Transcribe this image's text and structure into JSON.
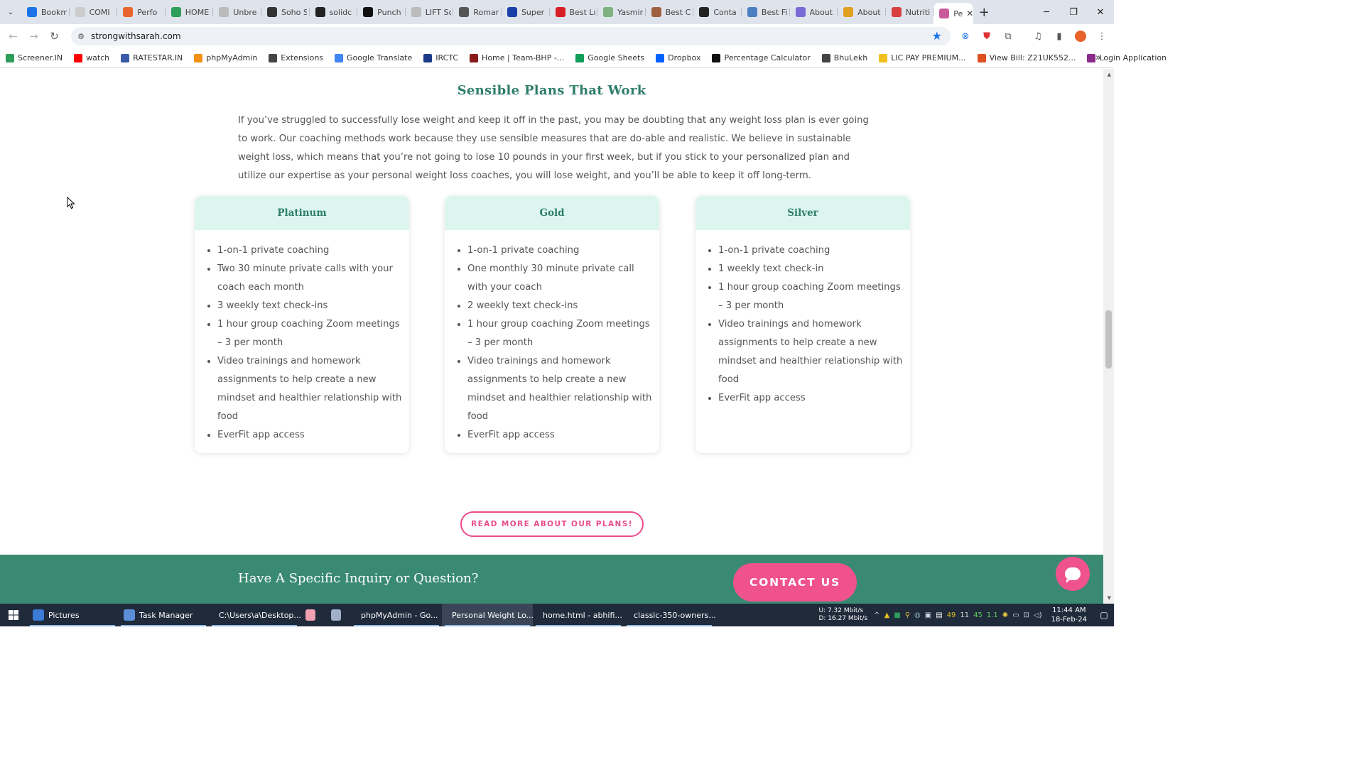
{
  "browser": {
    "tabs": [
      {
        "label": "Bookm",
        "icon": "star-icon",
        "color": "#1a73e8"
      },
      {
        "label": "COMI",
        "icon": "page-icon",
        "color": "#cccccc"
      },
      {
        "label": "Perfo",
        "icon": "p-logo-icon",
        "color": "#e8662e"
      },
      {
        "label": "HOME",
        "icon": "check-logo-icon",
        "color": "#2e9e5b"
      },
      {
        "label": "Unbre",
        "icon": "page-icon",
        "color": "#bbbbbb"
      },
      {
        "label": "Soho S",
        "icon": "ssl-icon",
        "color": "#333333"
      },
      {
        "label": "solidc",
        "icon": "s-logo-icon",
        "color": "#222222"
      },
      {
        "label": "Punch",
        "icon": "dash-icon",
        "color": "#111111"
      },
      {
        "label": "LIFT Sc",
        "icon": "page-icon",
        "color": "#bbbbbb"
      },
      {
        "label": "Roman",
        "icon": "r-logo-icon",
        "color": "#555555"
      },
      {
        "label": "Super",
        "icon": "circle-logo-icon",
        "color": "#1a3fa8"
      },
      {
        "label": "Best Lu",
        "icon": "red-logo-icon",
        "color": "#d81f26"
      },
      {
        "label": "Yasmin",
        "icon": "leaf-icon",
        "color": "#7fb27f"
      },
      {
        "label": "Best C",
        "icon": "food-icon",
        "color": "#a06040"
      },
      {
        "label": "Conta",
        "icon": "box-icon",
        "color": "#222222"
      },
      {
        "label": "Best Fi",
        "icon": "clock-icon",
        "color": "#4a7fc1"
      },
      {
        "label": "About",
        "icon": "wave-icon",
        "color": "#7a6ad8"
      },
      {
        "label": "About",
        "icon": "hands-icon",
        "color": "#e0a020"
      },
      {
        "label": "Nutriti",
        "icon": "red-circle-icon",
        "color": "#d84040"
      },
      {
        "label": "Pe",
        "icon": "butterfly-icon",
        "color": "#c85a9a"
      }
    ],
    "url": "strongwithsarah.com",
    "window_controls": {
      "minimize": "─",
      "restore": "❐",
      "close": "✕"
    }
  },
  "bookmarks": [
    {
      "label": "Screener.IN",
      "icon": "bar-chart-icon",
      "color": "#2e9e5b"
    },
    {
      "label": "watch",
      "icon": "youtube-icon",
      "color": "#ff0000"
    },
    {
      "label": "RATESTAR.IN",
      "icon": "star-logo-icon",
      "color": "#3a5aa8"
    },
    {
      "label": "phpMyAdmin",
      "icon": "php-icon",
      "color": "#f29111"
    },
    {
      "label": "Extensions",
      "icon": "puzzle-icon",
      "color": "#444444"
    },
    {
      "label": "Google Translate",
      "icon": "translate-icon",
      "color": "#4285f4"
    },
    {
      "label": "IRCTC",
      "icon": "irctc-icon",
      "color": "#1a3a8a"
    },
    {
      "label": "Home | Team-BHP -...",
      "icon": "bhp-icon",
      "color": "#8b1a1a"
    },
    {
      "label": "Google Sheets",
      "icon": "sheets-icon",
      "color": "#0f9d58"
    },
    {
      "label": "Dropbox",
      "icon": "dropbox-icon",
      "color": "#0061ff"
    },
    {
      "label": "Percentage Calculator",
      "icon": "percent-icon",
      "color": "#111111"
    },
    {
      "label": "BhuLekh",
      "icon": "globe-icon",
      "color": "#444444"
    },
    {
      "label": "LIC PAY PREMIUM...",
      "icon": "lic-icon",
      "color": "#f0c020"
    },
    {
      "label": "View Bill: Z21UK552...",
      "icon": "bill-icon",
      "color": "#e05020"
    },
    {
      "label": "Login Application",
      "icon": "login-icon",
      "color": "#8a2a8a"
    }
  ],
  "page": {
    "section_title": "Sensible Plans That Work",
    "intro": " If you’ve struggled to successfully lose weight and keep it off in the past, you may be doubting that any weight loss plan is ever going to work. Our coaching methods work because they use sensible measures that are do-able and realistic. We believe in sustainable weight loss, which means that you’re not going to lose 10 pounds in your first week, but if you stick to your personalized plan and utilize our expertise as your personal weight loss coaches, you will lose weight, and you’ll be able to keep it off long-term.",
    "plans": [
      {
        "name": "Platinum",
        "features": [
          "1-on-1 private coaching",
          "Two 30 minute private calls with your coach each month",
          "3 weekly text check-ins",
          "1 hour group coaching Zoom meetings – 3 per month",
          "Video trainings and homework assignments to help create a new mindset and healthier relationship with food",
          "EverFit app access"
        ]
      },
      {
        "name": "Gold",
        "features": [
          "1-on-1 private coaching",
          "One monthly 30 minute private call with your coach",
          "2 weekly text check-ins",
          "1 hour group coaching Zoom meetings – 3 per month",
          "Video trainings and homework assignments to help create a new mindset and healthier relationship with food",
          "EverFit app access"
        ]
      },
      {
        "name": "Silver",
        "features": [
          "1-on-1 private coaching",
          "1 weekly text check-in",
          "1 hour group coaching Zoom meetings – 3 per month",
          "Video trainings and homework assignments to help create a new mindset and healthier relationship with food",
          "EverFit app access"
        ]
      }
    ],
    "read_more": "READ MORE ABOUT OUR PLANS!",
    "inquiry": "Have A Specific Inquiry or Question?",
    "contact": "CONTACT US"
  },
  "taskbar": {
    "items": [
      {
        "label": "Pictures",
        "icon": "folder-icon",
        "color": "#3a7bd5",
        "state": "running"
      },
      {
        "label": "Task Manager",
        "icon": "task-manager-icon",
        "color": "#5a8fd8",
        "state": "running"
      },
      {
        "label": "C:\\Users\\a\\Desktop...",
        "icon": "notepad-icon",
        "color": "#58a058",
        "state": "running"
      },
      {
        "label": "",
        "icon": "pig-icon",
        "color": "#f0a0b0",
        "state": "normal"
      },
      {
        "label": "",
        "icon": "document-icon",
        "color": "#a0b0c8",
        "state": "normal"
      },
      {
        "label": "phpMyAdmin - Go...",
        "icon": "chrome-icon",
        "color": "#e04030",
        "state": "running"
      },
      {
        "label": "Personal Weight Lo...",
        "icon": "chrome-icon",
        "color": "#e04030",
        "state": "active"
      },
      {
        "label": "home.html - abhifi...",
        "icon": "vscode-icon",
        "color": "#2a88d8",
        "state": "running"
      },
      {
        "label": "classic-350-owners...",
        "icon": "pdf-viewer-icon",
        "color": "#e0c020",
        "state": "running"
      }
    ],
    "net_up": "U:   7.32 Mbit/s",
    "net_down": "D:  16.27 Mbit/s",
    "tray_numbers": [
      "49",
      "11",
      "45",
      "1.1"
    ],
    "time": "11:44 AM",
    "date": "18-Feb-24"
  }
}
